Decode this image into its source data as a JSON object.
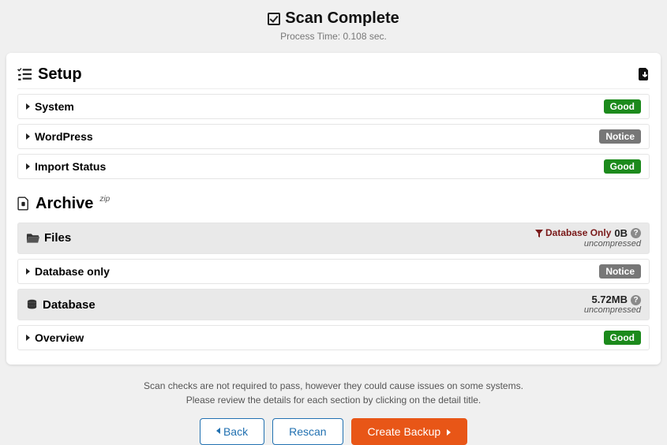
{
  "header": {
    "title": "Scan Complete",
    "subtitle": "Process Time: 0.108 sec."
  },
  "sections": {
    "setup": {
      "title": "Setup",
      "rows": {
        "system": {
          "label": "System",
          "badge": "Good",
          "badge_class": "good"
        },
        "wordpress": {
          "label": "WordPress",
          "badge": "Notice",
          "badge_class": "notice"
        },
        "import": {
          "label": "Import Status",
          "badge": "Good",
          "badge_class": "good"
        }
      }
    },
    "archive": {
      "title": "Archive",
      "suffix": "zip",
      "files": {
        "label": "Files",
        "filter_label": "Database Only",
        "size": "0B",
        "sub": "uncompressed",
        "rows": {
          "dbonly": {
            "label": "Database only",
            "badge": "Notice",
            "badge_class": "notice"
          }
        }
      },
      "database": {
        "label": "Database",
        "size": "5.72MB",
        "sub": "uncompressed",
        "rows": {
          "overview": {
            "label": "Overview",
            "badge": "Good",
            "badge_class": "good"
          }
        }
      }
    }
  },
  "footer": {
    "line1": "Scan checks are not required to pass, however they could cause issues on some systems.",
    "line2": "Please review the details for each section by clicking on the detail title.",
    "buttons": {
      "back": "Back",
      "rescan": "Rescan",
      "create": "Create Backup"
    }
  }
}
